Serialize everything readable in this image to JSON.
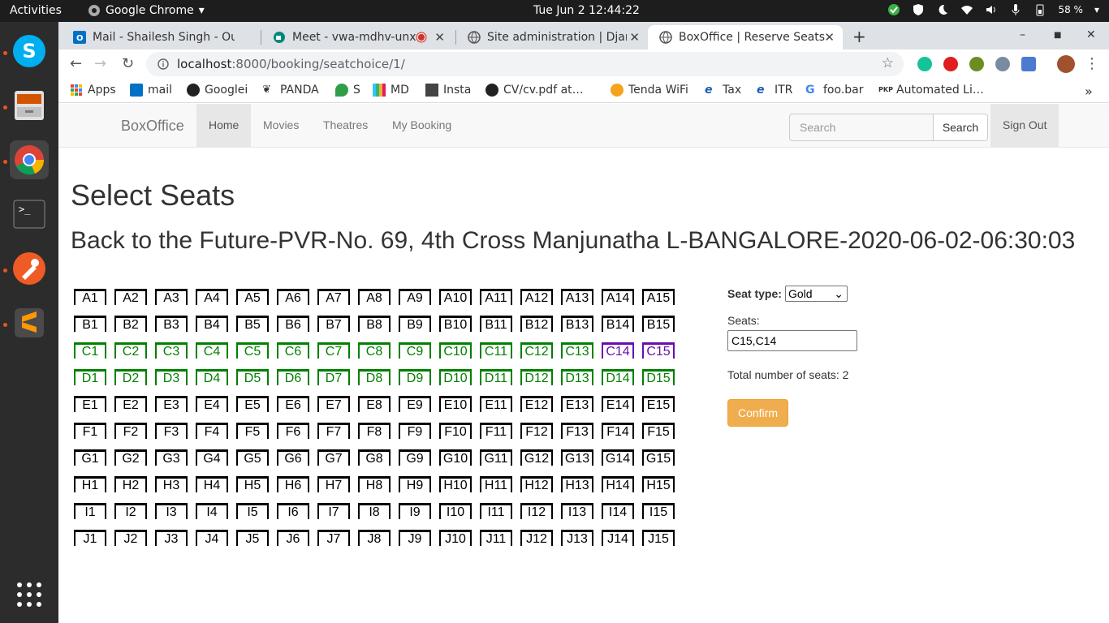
{
  "system": {
    "activities": "Activities",
    "app_menu": "Google Chrome",
    "clock": "Tue Jun 2  12:44:22",
    "battery": "58 %"
  },
  "browser": {
    "tabs": [
      {
        "title": "Mail - Shailesh Singh - Out"
      },
      {
        "title": "Meet - vwa-mdhv-unx"
      },
      {
        "title": "Site administration | Djan"
      },
      {
        "title": "BoxOffice | Reserve Seats",
        "active": true
      }
    ],
    "url_host": "localhost",
    "url_path": ":8000/booking/seatchoice/1/",
    "bookmarks": [
      "Apps",
      "mail",
      "Googlei",
      "PANDA",
      "S",
      "MD",
      "Insta",
      "CV/cv.pdf at…",
      "Tenda WiFi",
      "Tax",
      "ITR",
      "foo.bar",
      "Automated Li…"
    ]
  },
  "navbar": {
    "brand": "BoxOffice",
    "links": [
      "Home",
      "Movies",
      "Theatres",
      "My Booking"
    ],
    "search_placeholder": "Search",
    "search_button": "Search",
    "signout": "Sign Out"
  },
  "main": {
    "title": "Select Seats",
    "show": "Back to the Future-PVR-No. 69, 4th Cross Manjunatha L-BANGALORE-2020-06-02-06:30:03"
  },
  "seatmap": {
    "rows": [
      "A",
      "B",
      "C",
      "D",
      "E",
      "F",
      "G",
      "H",
      "I",
      "J"
    ],
    "columns": 15,
    "available_rows": [
      "C",
      "D"
    ],
    "selected": [
      "C14",
      "C15"
    ],
    "colors": {
      "default": "#000000",
      "available": "#008000",
      "selected": "#6a0dad"
    }
  },
  "form": {
    "seat_type_label": "Seat type:",
    "seat_type_value": "Gold",
    "seats_label": "Seats:",
    "seats_value": "C15,C14",
    "total_label": "Total number of seats: 2",
    "confirm": "Confirm"
  }
}
